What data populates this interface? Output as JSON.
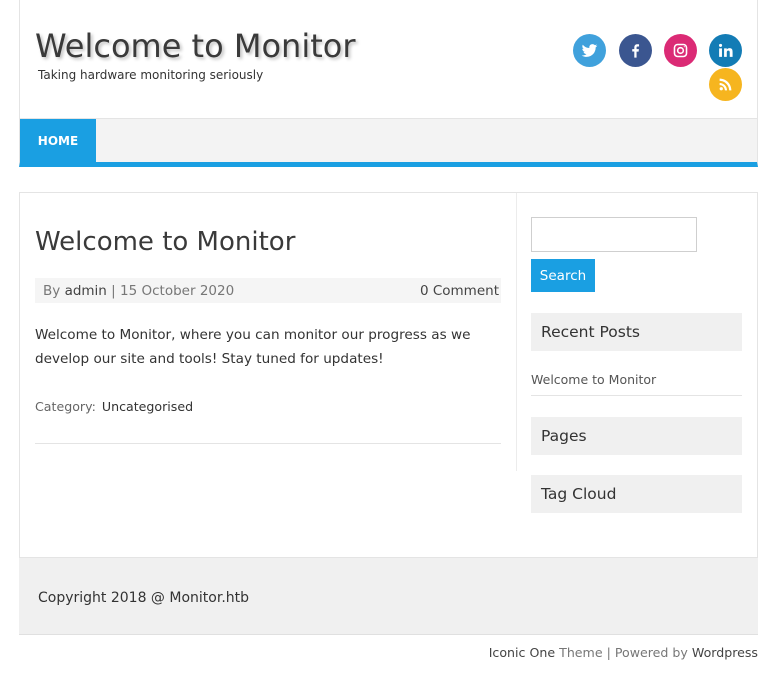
{
  "header": {
    "site_title": "Welcome to Monitor",
    "tagline": "Taking hardware monitoring seriously"
  },
  "social": [
    {
      "name": "twitter-icon",
      "color": "#40a1dc"
    },
    {
      "name": "facebook-icon",
      "color": "#3b5690"
    },
    {
      "name": "instagram-icon",
      "color": "#db2a75"
    },
    {
      "name": "linkedin-icon",
      "color": "#137cb5"
    },
    {
      "name": "rss-icon",
      "color": "#f6b51f"
    }
  ],
  "nav": {
    "home_label": "HOME",
    "accent_color": "#1a9fe2"
  },
  "post": {
    "title": "Welcome to Monitor",
    "by_label": "By",
    "author": "admin",
    "separator": "|",
    "date": "15 October 2020",
    "comments": "0 Comment",
    "body": "Welcome to Monitor, where you can monitor our progress as we develop our site and tools! Stay tuned for updates!",
    "category_label": "Category:",
    "category": "Uncategorised"
  },
  "sidebar": {
    "search_placeholder": "",
    "search_button": "Search",
    "recent_posts_title": "Recent Posts",
    "recent_posts": [
      "Welcome to Monitor"
    ],
    "pages_title": "Pages",
    "tag_cloud_title": "Tag Cloud"
  },
  "footer": {
    "copyright": "Copyright 2018 @ Monitor.htb",
    "theme_name": "Iconic One",
    "theme_label": "Theme",
    "powered_label": "| Powered by",
    "powered_link": "Wordpress"
  }
}
